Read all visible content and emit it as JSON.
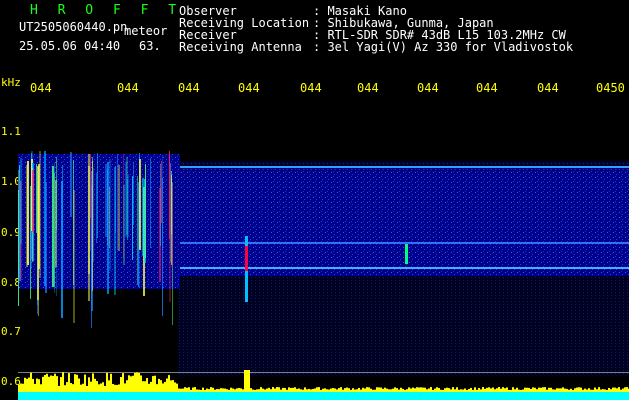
{
  "header": {
    "brand": "H R O F F T",
    "filename": "UT2505060440.pn",
    "type_label": "meteor",
    "datetime": "25.05.06 04:40",
    "count": "63.",
    "fields": [
      {
        "label": "Observer",
        "value": ": Masaki Kano"
      },
      {
        "label": "Receiving Location",
        "value": ": Shibukawa, Gunma, Japan"
      },
      {
        "label": "Receiver",
        "value": ": RTL-SDR SDR# 43dB L15 103.2MHz CW"
      },
      {
        "label": "Receiving Antenna",
        "value": ": 3el Yagi(V) Az 330 for Vladivostok"
      }
    ]
  },
  "axes": {
    "y_title": "kHz",
    "y_ticks": [
      "1.1",
      "1.0",
      "0.9",
      "0.8",
      "0.7",
      "0.6"
    ],
    "x_ticks": [
      "044",
      "044",
      "044",
      "044",
      "044",
      "044",
      "044",
      "044",
      "044",
      "0450"
    ]
  },
  "colors": {
    "text": "#ffffff",
    "axis": "#ffff00",
    "brand": "#19ff19",
    "background": "#000000",
    "spectrum_floor": "#00007a",
    "bar": "#ffff00",
    "bar_base": "#00ffff"
  }
}
